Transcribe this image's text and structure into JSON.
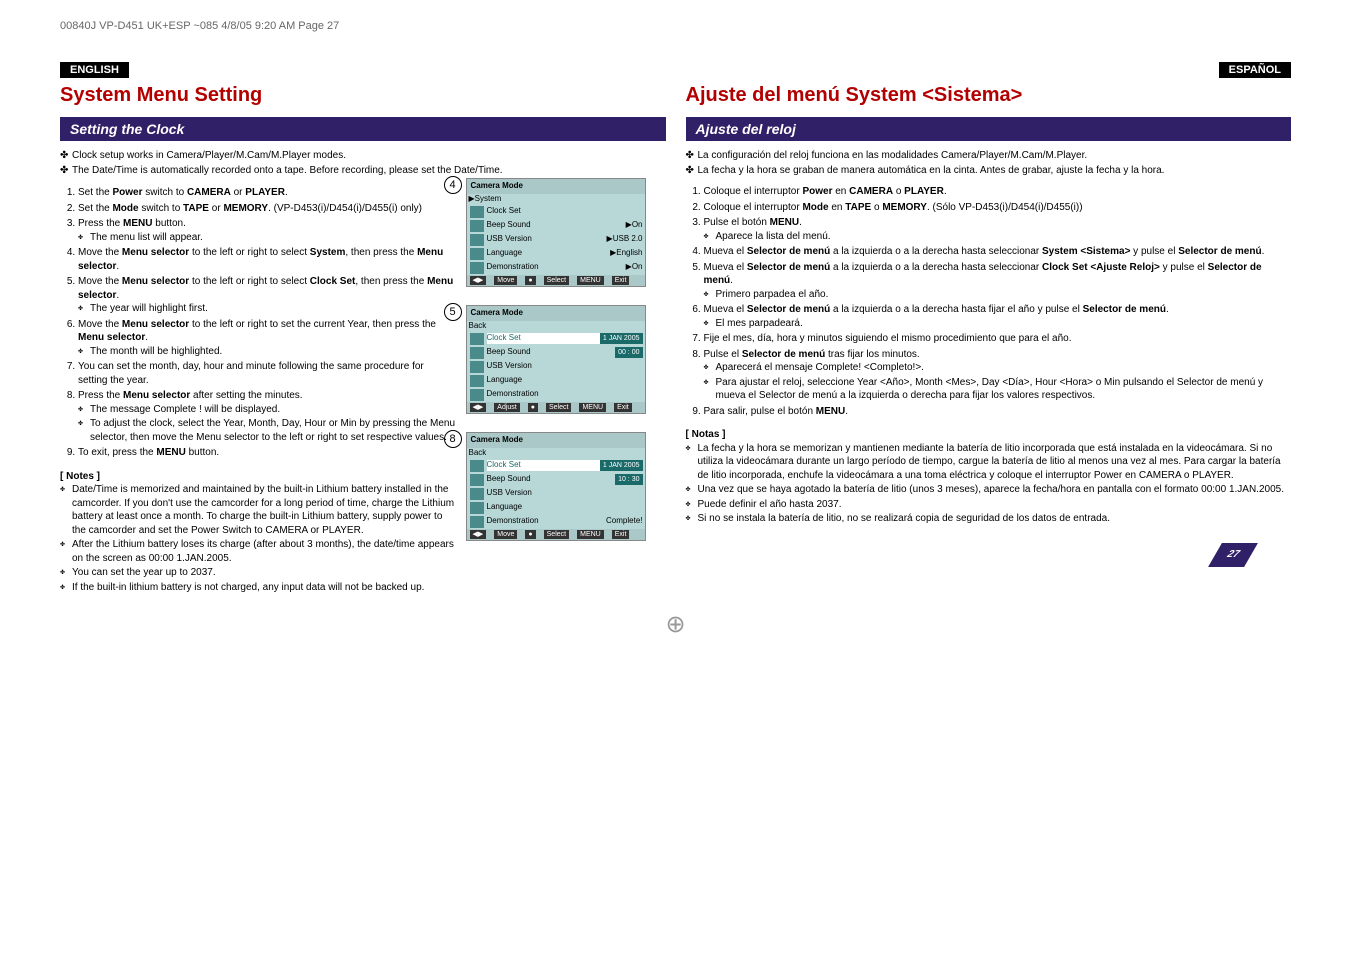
{
  "header_line": "00840J VP-D451 UK+ESP ~085  4/8/05 9:20 AM  Page 27",
  "left": {
    "lang": "ENGLISH",
    "title": "System Menu Setting",
    "section": "Setting the Clock",
    "bullets": [
      "Clock setup works in Camera/Player/M.Cam/M.Player modes.",
      "The Date/Time is automatically recorded onto a tape. Before recording, please set the Date/Time."
    ],
    "steps": [
      {
        "text": "Set the ",
        "bold1": "Power",
        "mid": " switch to ",
        "bold2": "CAMERA",
        "mid2": " or ",
        "bold3": "PLAYER",
        "end": "."
      },
      {
        "text": "Set the ",
        "bold1": "Mode",
        "mid": " switch to ",
        "bold2": "TAPE",
        "mid2": " or ",
        "bold3": "MEMORY",
        "end": ". (VP-D453(i)/D454(i)/D455(i) only)"
      },
      {
        "text": "Press the ",
        "bold1": "MENU",
        "mid": " button.",
        "sub": [
          "The menu list will appear."
        ]
      },
      {
        "text": "Move the ",
        "bold1": "Menu selector",
        "mid": " to the left or right to select ",
        "bold2": "System",
        "mid2": ", then press the ",
        "bold3": "Menu selector",
        "end": "."
      },
      {
        "text": "Move the ",
        "bold1": "Menu selector",
        "mid": " to the left or right to select ",
        "bold2": "Clock Set",
        "mid2": ", then press the ",
        "bold3": "Menu selector",
        "end": ".",
        "sub": [
          "The year will highlight first."
        ]
      },
      {
        "text": "Move the ",
        "bold1": "Menu selector",
        "mid": " to the left or right to set the current Year, then press the ",
        "bold2": "Menu selector",
        "end": ".",
        "sub": [
          "The month will be highlighted."
        ]
      },
      {
        "text": "You can set the month, day, hour and minute following the same procedure for setting the year."
      },
      {
        "text": "Press the ",
        "bold1": "Menu selector",
        "mid": " after setting the minutes.",
        "sub": [
          "The message Complete ! will be displayed.",
          "To adjust the clock, select the Year, Month, Day, Hour or Min by pressing the Menu selector, then move the Menu selector to the left or right to set respective values."
        ]
      },
      {
        "text": "To exit, press the ",
        "bold1": "MENU",
        "mid": " button."
      }
    ],
    "notes_h": "[ Notes ]",
    "notes": [
      "Date/Time is memorized and maintained by the built-in Lithium battery installed in the camcorder. If you don't use the camcorder for a long period of time, charge the Lithium battery at least once a month. To charge the built-in Lithium battery, supply power to the camcorder and set the Power Switch to CAMERA or PLAYER.",
      "After the Lithium battery loses its charge (after about 3 months), the date/time appears on the screen as 00:00 1.JAN.2005.",
      "You can set the year up to 2037.",
      "If the built-in lithium battery is not charged, any input data will not be backed up."
    ]
  },
  "right": {
    "lang": "ESPAÑOL",
    "title": "Ajuste del menú System <Sistema>",
    "section": "Ajuste del reloj",
    "bullets": [
      "La configuración del reloj funciona en las modalidades Camera/Player/M.Cam/M.Player.",
      "La fecha y la hora se graban de manera automática en la cinta. Antes de grabar, ajuste la fecha y la hora."
    ],
    "steps": [
      {
        "text": "Coloque el interruptor ",
        "bold1": "Power",
        "mid": " en ",
        "bold2": "CAMERA",
        "mid2": " o ",
        "bold3": "PLAYER",
        "end": "."
      },
      {
        "text": "Coloque el interruptor ",
        "bold1": "Mode",
        "mid": " en ",
        "bold2": "TAPE",
        "mid2": " o ",
        "bold3": "MEMORY",
        "end": ". (Sólo VP-D453(i)/D454(i)/D455(i))"
      },
      {
        "text": "Pulse el botón ",
        "bold1": "MENU",
        "end": ".",
        "sub": [
          "Aparece la lista del menú."
        ]
      },
      {
        "text": "Mueva el ",
        "bold1": "Selector de menú",
        "mid": " a la izquierda o a la derecha hasta seleccionar ",
        "bold2": "System <Sistema>",
        "mid2": " y pulse el ",
        "bold3": "Selector de menú",
        "end": "."
      },
      {
        "text": "Mueva el ",
        "bold1": "Selector de menú",
        "mid": " a la izquierda o a la derecha hasta seleccionar ",
        "bold2": "Clock Set <Ajuste Reloj>",
        "mid2": " y pulse el ",
        "bold3": "Selector de menú",
        "end": ".",
        "sub": [
          "Primero parpadea el año."
        ]
      },
      {
        "text": "Mueva el ",
        "bold1": "Selector de menú",
        "mid": " a la izquierda o a la derecha hasta fijar el año y pulse el ",
        "bold2": "Selector de menú",
        "end": ".",
        "sub": [
          "El mes parpadeará."
        ]
      },
      {
        "text": "Fije el mes, día, hora y minutos siguiendo el mismo procedimiento que para el año."
      },
      {
        "text": "Pulse el ",
        "bold1": "Selector de menú",
        "mid": " tras fijar los minutos.",
        "sub": [
          "Aparecerá el mensaje Complete! <Completo!>.",
          "Para ajustar el reloj, seleccione Year <Año>, Month <Mes>, Day <Día>, Hour <Hora> o Min pulsando el Selector de menú y mueva el Selector de menú a la izquierda o derecha para fijar los valores respectivos."
        ]
      },
      {
        "text": "Para salir, pulse el botón ",
        "bold1": "MENU",
        "end": "."
      }
    ],
    "notes_h": "[ Notas ]",
    "notes": [
      "La fecha y la hora se memorizan y mantienen mediante la batería de litio incorporada que está instalada en la videocámara. Si no utiliza la videocámara durante un largo período de tiempo, cargue la batería de litio al menos una vez al mes. Para cargar la batería de litio incorporada, enchufe la videocámara a una toma eléctrica y coloque el interruptor Power en CAMERA o PLAYER.",
      "Una vez que se haya agotado la batería de litio (unos 3 meses), aparece la fecha/hora en pantalla con el formato  00:00 1.JAN.2005.",
      "Puede definir el año hasta 2037.",
      "Si no se instala la batería de litio, no se realizará copia de seguridad de los datos de entrada."
    ]
  },
  "figs": {
    "f4": {
      "num": "4",
      "title": "Camera Mode",
      "section": "▶System",
      "rows": [
        {
          "label": "Clock Set",
          "val": ""
        },
        {
          "label": "Beep Sound",
          "val": "▶On"
        },
        {
          "label": "USB Version",
          "val": "▶USB 2.0"
        },
        {
          "label": "Language",
          "val": "▶English"
        },
        {
          "label": "Demonstration",
          "val": "▶On"
        }
      ],
      "foot_move": "Move",
      "foot_select": "Select",
      "foot_exit": "Exit",
      "foot_menu": "MENU"
    },
    "f5": {
      "num": "5",
      "title": "Camera Mode",
      "back": "Back",
      "rows": [
        {
          "label": "Clock Set",
          "val": "1  JAN  2005",
          "sel": true,
          "time": "00 : 00"
        },
        {
          "label": "Beep Sound",
          "val": ""
        },
        {
          "label": "USB Version",
          "val": ""
        },
        {
          "label": "Language",
          "val": ""
        },
        {
          "label": "Demonstration",
          "val": ""
        }
      ],
      "foot_move": "Adjust",
      "foot_select": "Select",
      "foot_exit": "Exit",
      "foot_menu": "MENU"
    },
    "f8": {
      "num": "8",
      "title": "Camera Mode",
      "back": "Back",
      "rows": [
        {
          "label": "Clock Set",
          "val": "1  JAN  2005",
          "sel": true,
          "time": "10 : 30"
        },
        {
          "label": "Beep Sound",
          "val": ""
        },
        {
          "label": "USB Version",
          "val": ""
        },
        {
          "label": "Language",
          "val": ""
        },
        {
          "label": "Demonstration",
          "val": "Complete!"
        }
      ],
      "foot_move": "Move",
      "foot_select": "Select",
      "foot_exit": "Exit",
      "foot_menu": "MENU"
    }
  },
  "page_num": "27"
}
